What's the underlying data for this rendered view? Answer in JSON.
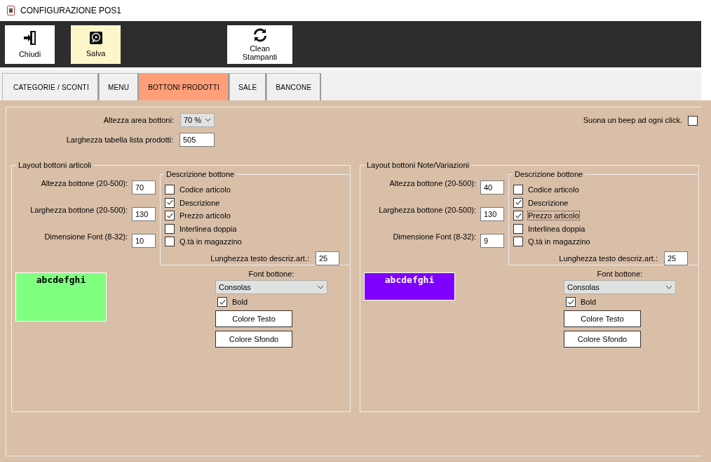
{
  "window": {
    "title": "CONFIGURAZIONE POS1"
  },
  "toolbar": [
    {
      "label": "Chiudi",
      "kind": "exit",
      "highlighted": false
    },
    {
      "label": "Salva",
      "kind": "save",
      "highlighted": true
    },
    {
      "label": "Clean Stampanti",
      "kind": "refresh",
      "highlighted": false
    }
  ],
  "tabs": [
    {
      "label": "CATEGORIE / SCONTI",
      "selected": false
    },
    {
      "label": "MENU",
      "selected": false
    },
    {
      "label": "BOTTONI PRODOTTI",
      "selected": true
    },
    {
      "label": "SALE",
      "selected": false
    },
    {
      "label": "BANCONE",
      "selected": false
    }
  ],
  "settings": {
    "button_area_height": {
      "label": "Altezza area bottoni:",
      "value": "70 %"
    },
    "list_width": {
      "label": "Larghezza tabella lista prodotti:",
      "value": "505"
    },
    "beep": {
      "label": "Suona un beep ad ogni click.",
      "checked": false
    }
  },
  "panels": [
    {
      "title": "Layout bottoni articoli",
      "fields": [
        {
          "label": "Altezza bottone (20-500):",
          "value": "70"
        },
        {
          "label": "Larghezza bottone (20-500):",
          "value": "130"
        },
        {
          "label": "Dimensione Font (8-32):",
          "value": "10"
        }
      ],
      "description": {
        "title": "Descrizione bottone",
        "options": [
          {
            "label": "Codice articolo",
            "checked": false,
            "focused": false
          },
          {
            "label": "Descrizione",
            "checked": true,
            "focused": false
          },
          {
            "label": "Prezzo articolo",
            "checked": true,
            "focused": false
          },
          {
            "label": "Interlinea doppia",
            "checked": false,
            "focused": false
          },
          {
            "label": "Q.tà in magazzino",
            "checked": false,
            "focused": false
          }
        ],
        "length": {
          "label": "Lunghezza testo descriz.art.:",
          "value": "25"
        }
      },
      "preview": {
        "text": "abcdefghi",
        "color": "#80ff80"
      },
      "font": {
        "label": "Font bottone:",
        "value": "Consolas",
        "bold": {
          "label": "Bold",
          "checked": true
        }
      },
      "buttons": [
        "Colore Testo",
        "Colore Sfondo"
      ]
    },
    {
      "title": "Layout bottoni Note/Variazioni",
      "fields": [
        {
          "label": "Altezza bottone (20-500):",
          "value": "40"
        },
        {
          "label": "Larghezza bottone (20-500):",
          "value": "130"
        },
        {
          "label": "Dimensione Font (8-32):",
          "value": "9"
        }
      ],
      "description": {
        "title": "Descrizione bottone",
        "options": [
          {
            "label": "Codice articolo",
            "checked": false,
            "focused": false
          },
          {
            "label": "Descrizione",
            "checked": true,
            "focused": false
          },
          {
            "label": "Prezzo articolo",
            "checked": true,
            "focused": true
          },
          {
            "label": "Interlinea doppia",
            "checked": false,
            "focused": false
          },
          {
            "label": "Q.tà in magazzino",
            "checked": false,
            "focused": false
          }
        ],
        "length": {
          "label": "Lunghezza testo descriz.art.:",
          "value": "25"
        }
      },
      "preview": {
        "text": "abcdefghi",
        "color": "#8000ff"
      },
      "font": {
        "label": "Font bottone:",
        "value": "Consolas",
        "bold": {
          "label": "Bold",
          "checked": true
        }
      },
      "buttons": [
        "Colore Testo",
        "Colore Sfondo"
      ]
    }
  ]
}
